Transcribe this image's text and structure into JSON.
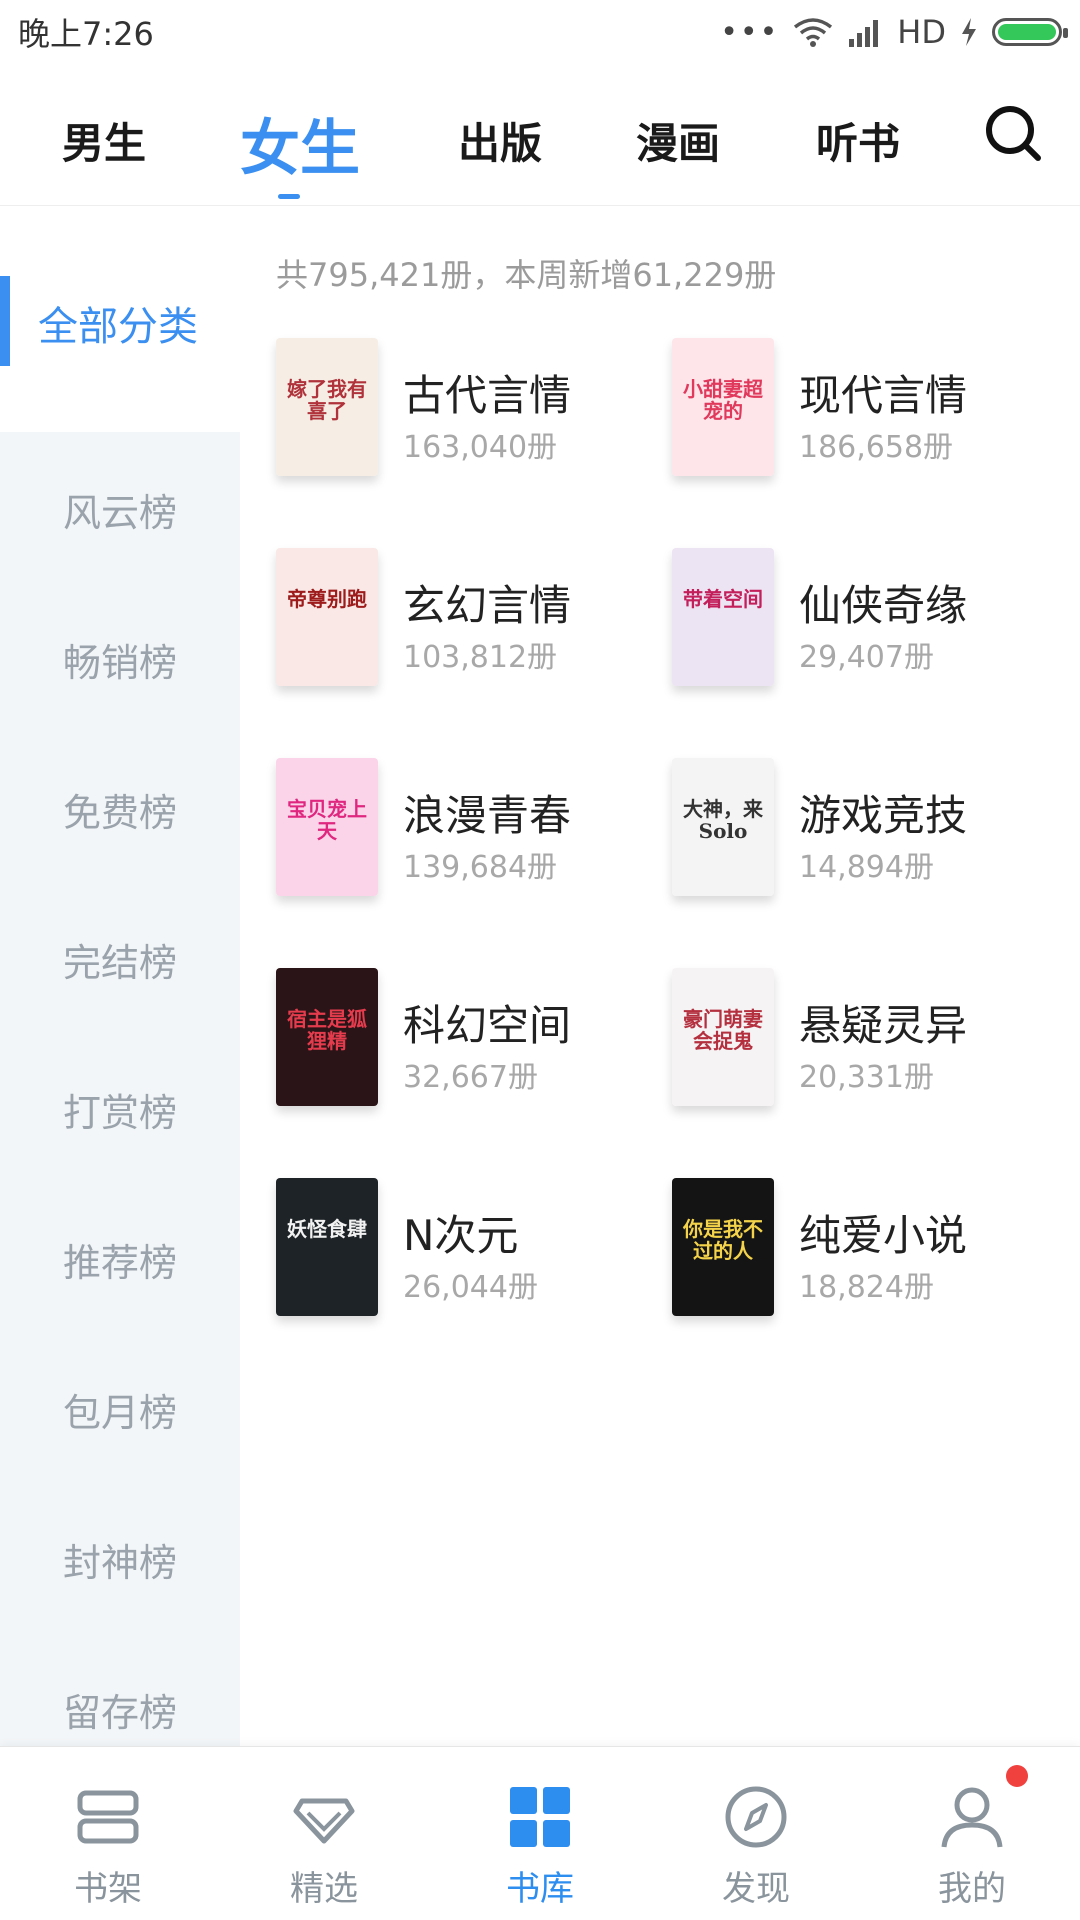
{
  "status_bar": {
    "time": "晚上7:26",
    "dots": "•••",
    "network": "HD"
  },
  "top_tabs": [
    {
      "label": "男生",
      "active": false
    },
    {
      "label": "女生",
      "active": true
    },
    {
      "label": "出版",
      "active": false
    },
    {
      "label": "漫画",
      "active": false
    },
    {
      "label": "听书",
      "active": false
    }
  ],
  "sidebar": {
    "active": "全部分类",
    "items": [
      "风云榜",
      "畅销榜",
      "免费榜",
      "完结榜",
      "打赏榜",
      "推荐榜",
      "包月榜",
      "封神榜",
      "留存榜"
    ]
  },
  "summary": "共795,421册，本周新增61,229册",
  "categories": [
    {
      "name": "古代言情",
      "count": "163,040册"
    },
    {
      "name": "现代言情",
      "count": "186,658册"
    },
    {
      "name": "玄幻言情",
      "count": "103,812册"
    },
    {
      "name": "仙侠奇缘",
      "count": "29,407册"
    },
    {
      "name": "浪漫青春",
      "count": "139,684册"
    },
    {
      "name": "游戏竞技",
      "count": "14,894册"
    },
    {
      "name": "科幻空间",
      "count": "32,667册"
    },
    {
      "name": "悬疑灵异",
      "count": "20,331册"
    },
    {
      "name": "N次元",
      "count": "26,044册"
    },
    {
      "name": "纯爱小说",
      "count": "18,824册"
    }
  ],
  "covers": [
    {
      "title": "嫁了我有喜了",
      "bg": "#f6ede4",
      "fg": "#b0323b"
    },
    {
      "title": "小甜妻超宠的",
      "bg": "#fde5ea",
      "fg": "#e0395c"
    },
    {
      "title": "帝尊别跑",
      "bg": "#f9e8e6",
      "fg": "#9d1b1b"
    },
    {
      "title": "带着空间",
      "bg": "#ece3f3",
      "fg": "#c3205b"
    },
    {
      "title": "宝贝宠上天",
      "bg": "#fbd4ea",
      "fg": "#e02780"
    },
    {
      "title": "大神，来Solo",
      "bg": "#f4f4f4",
      "fg": "#333333"
    },
    {
      "title": "宿主是狐狸精",
      "bg": "#2a1417",
      "fg": "#e43b4d"
    },
    {
      "title": "豪门萌妻会捉鬼",
      "bg": "#f6f3f5",
      "fg": "#b4303f"
    },
    {
      "title": "妖怪食肆",
      "bg": "#1e2327",
      "fg": "#f1f1f1"
    },
    {
      "title": "你是我不过的人",
      "bg": "#141414",
      "fg": "#f4d34a"
    }
  ],
  "bottom_nav": [
    {
      "label": "书架",
      "icon": "bookshelf-icon",
      "active": false
    },
    {
      "label": "精选",
      "icon": "diamond-icon",
      "active": false
    },
    {
      "label": "书库",
      "icon": "grid-icon",
      "active": true
    },
    {
      "label": "发现",
      "icon": "compass-icon",
      "active": false
    },
    {
      "label": "我的",
      "icon": "user-icon",
      "active": false,
      "badge": true
    }
  ],
  "colors": {
    "accent": "#3a8ff0",
    "badge": "#f0413f",
    "battery": "#34c759"
  }
}
